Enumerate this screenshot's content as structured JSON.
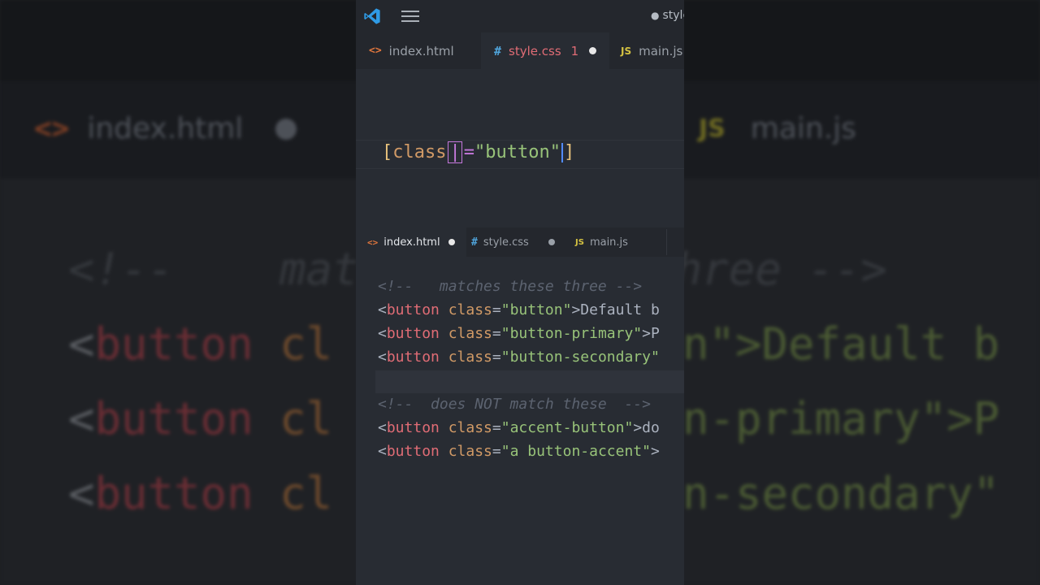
{
  "window": {
    "title": "style"
  },
  "top_tabs": [
    {
      "label": "index.html",
      "icon": "html-code-icon",
      "active": false
    },
    {
      "label": "style.css",
      "icon": "css-hash-icon",
      "active": true,
      "problems": "1",
      "modified": true
    },
    {
      "label": "main.js",
      "icon": "js-icon",
      "active": false
    }
  ],
  "selector_editor": {
    "open_bracket": "[",
    "attr": "class",
    "pipe": "|",
    "equals": "=",
    "value": "\"button\"",
    "close_bracket": "]"
  },
  "bottom_tabs": [
    {
      "label": "index.html",
      "icon": "html-code-icon",
      "active": true,
      "modified": true
    },
    {
      "label": "style.css",
      "icon": "css-hash-icon",
      "active": false,
      "modified": true
    },
    {
      "label": "main.js",
      "icon": "js-icon",
      "active": false
    }
  ],
  "html_code": {
    "comment_match": "<!--   matches these three -->",
    "comment_nomatch": "<!--  does NOT match these  -->",
    "lines_match": [
      {
        "class_value": "\"button\"",
        "tail": ">Default b"
      },
      {
        "class_value": "\"button-primary\"",
        "tail": ">P"
      },
      {
        "class_value": "\"button-secondary\"",
        "tail": ""
      }
    ],
    "lines_nomatch": [
      {
        "class_value": "\"accent-button\"",
        "tail": ">do"
      },
      {
        "class_value": "\"a button-accent\"",
        "tail": ">"
      }
    ],
    "open_angle": "<",
    "tag": "button",
    "attr": " class",
    "eq": "="
  },
  "background": {
    "tab_html": "index.html",
    "tab_js": "main.js",
    "icon_html": "<>",
    "icon_js": "JS",
    "comment": "<!--    matches these three -->",
    "line1_tail": "n\">Default b",
    "line2_tail": "n-primary\">P",
    "line3_tail": "n-secondary\"",
    "tag_fragment": "button",
    "attr_fragment": "cl",
    "open_angle": "<"
  },
  "colors": {
    "accent_blue": "#528bff",
    "tag_red": "#e06c75",
    "attr_orange": "#d19a66",
    "string_green": "#98c379",
    "bracket_yellow": "#e5c07b",
    "operator_purple": "#c678dd",
    "comment_gray": "#5c6370"
  }
}
